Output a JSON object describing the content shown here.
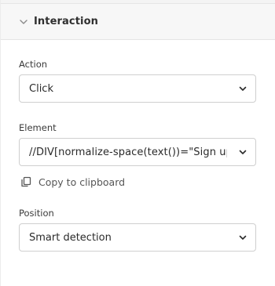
{
  "section": {
    "title": "Interaction",
    "collapse_icon": "chevron-down-icon"
  },
  "action": {
    "label": "Action",
    "value": "Click",
    "icon": "chevron-down-icon"
  },
  "element": {
    "label": "Element",
    "value": "//DIV[normalize-space(text())=\"Sign up\"]",
    "icon": "chevron-down-icon"
  },
  "copy": {
    "label": "Copy to clipboard",
    "icon": "copy-icon"
  },
  "position": {
    "label": "Position",
    "value": "Smart detection",
    "icon": "chevron-down-icon"
  },
  "colors": {
    "border": "#cfcfcf",
    "header_bg": "#f7f7f7",
    "text": "#2a2a2a",
    "muted": "#555555"
  }
}
